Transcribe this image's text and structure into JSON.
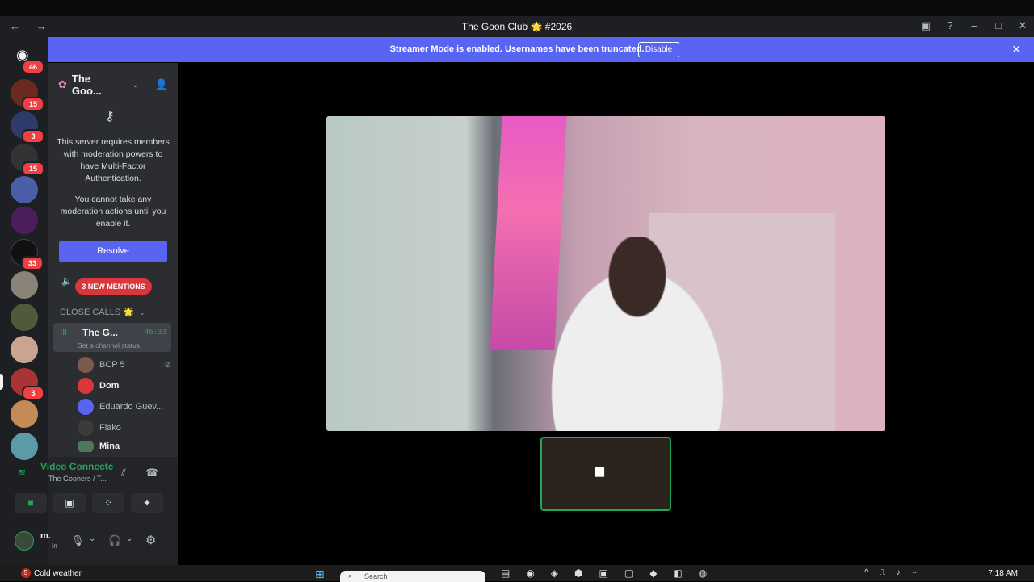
{
  "window": {
    "title": "The Goon Club 🌟 #2026",
    "nav": "← →"
  },
  "banner": {
    "text": "Streamer Mode is enabled. Usernames have been truncated.",
    "disable_label": "Disable"
  },
  "guilds": [
    {
      "badge": "46"
    },
    {
      "badge": "15"
    },
    {
      "badge": "3"
    },
    {
      "badge": "15"
    },
    {
      "badge": ""
    },
    {
      "badge": ""
    },
    {
      "badge": "33"
    },
    {
      "badge": ""
    },
    {
      "badge": ""
    },
    {
      "badge": ""
    },
    {
      "badge": "3"
    },
    {
      "badge": ""
    },
    {
      "badge": ""
    }
  ],
  "server": {
    "name": "The Goo...",
    "mfa_text_1": "This server requires members with moderation powers to have Multi-Factor Authentication.",
    "mfa_text_2": "You cannot take any moderation actions until you enable it.",
    "resolve_label": "Resolve",
    "mentions_label": "3 NEW MENTIONS",
    "category": "CLOSE CALLS 🌟",
    "voice_channel": {
      "name": "The G...",
      "time": "46:33",
      "status": "Set a channel status"
    },
    "members": [
      {
        "name": "BCP 5"
      },
      {
        "name": "Dom"
      },
      {
        "name": "Eduardo Guev..."
      },
      {
        "name": "Flako"
      },
      {
        "name": "Mina"
      }
    ]
  },
  "voice": {
    "title": "Video Connecte",
    "subtitle": "The Gooners / T..."
  },
  "user": {
    "name": "m.",
    "status": "In"
  },
  "taskbar": {
    "weather_badge": "5",
    "weather": "Cold weather",
    "search": "Search",
    "time": "7:18 AM"
  }
}
